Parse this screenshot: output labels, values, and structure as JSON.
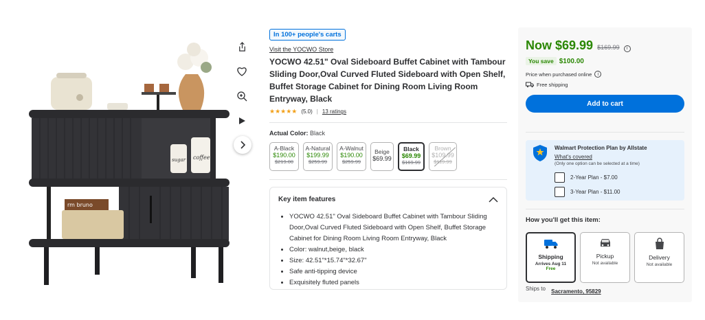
{
  "gallery": {
    "icons": [
      "share-icon",
      "heart-icon",
      "zoom-icon",
      "play-video-icon"
    ],
    "next_icon": "chevron-right-icon",
    "basket_label": "rm bruno",
    "canister_labels": [
      "sugar",
      "coffee"
    ]
  },
  "product": {
    "badge": "In 100+ people's carts",
    "store_link": "Visit the YOCWO Store",
    "title": "YOCWO 42.51\" Oval Sideboard Buffet Cabinet with Tambour Sliding Door,Oval Curved Fluted Sideboard with Open Shelf, Buffet Storage Cabinet for Dining Room Living Room Entryway, Black",
    "stars": "★★★★★",
    "rating": "(5.0)",
    "rating_sep": "|",
    "ratings_count": "13 ratings"
  },
  "color": {
    "label": "Actual Color:",
    "selected": "Black",
    "variants": [
      {
        "name": "A-Black",
        "price": "$190.00",
        "was": "$219.00"
      },
      {
        "name": "A-Natural",
        "price": "$199.99",
        "was": "$259.99"
      },
      {
        "name": "A-Walnut",
        "price": "$190.00",
        "was": "$259.99"
      },
      {
        "name": "Beige",
        "price": "$69.99",
        "was": ""
      },
      {
        "name": "Black",
        "price": "$69.99",
        "was": "$169.99"
      },
      {
        "name": "Brown",
        "price": "$109.99",
        "was": "$119.99"
      }
    ]
  },
  "features": {
    "heading": "Key item features",
    "items": [
      "YOCWO 42.51\" Oval Sideboard Buffet Cabinet with Tambour Sliding Door,Oval Curved Fluted Sideboard with Open Shelf, Buffet Storage Cabinet for Dining Room Living Room Entryway, Black",
      "Color: walnut,beige, black",
      "Size: 42.51\"*15.74\"*32.67\"",
      "Safe anti-tipping device",
      "Exquisitely fluted panels"
    ]
  },
  "buy_box": {
    "now_price": "Now $69.99",
    "was_price": "$169.99",
    "you_save_label": "You save",
    "you_save_amount": "$100.00",
    "price_note": "Price when purchased online",
    "free_shipping": "Free shipping",
    "add_to_cart": "Add to cart"
  },
  "protection": {
    "title": "Walmart Protection Plan by Allstate",
    "link": "What's covered",
    "note": "(Only one option can be selected at a time)",
    "plans": [
      "2-Year Plan - $7.00",
      "3-Year Plan - $11.00"
    ]
  },
  "fulfillment": {
    "heading": "How you'll get this item:",
    "options": [
      {
        "name": "Shipping",
        "sub": "Arrives Aug 11",
        "extra": "Free",
        "icon": "truck-icon"
      },
      {
        "name": "Pickup",
        "sub": "Not available",
        "extra": "",
        "icon": "car-icon"
      },
      {
        "name": "Delivery",
        "sub": "Not available",
        "extra": "",
        "icon": "bag-icon"
      }
    ],
    "ships_to_label": "Ships to",
    "location": "Sacramento, 95829"
  },
  "colors": {
    "brand_blue": "#0071dc",
    "price_green": "#2a8703",
    "star": "#f2a01a"
  }
}
